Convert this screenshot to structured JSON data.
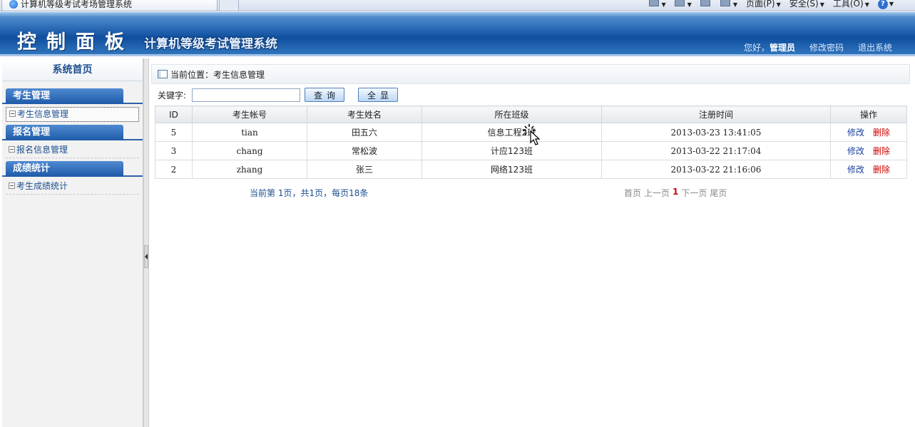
{
  "browser": {
    "tab_title": "计算机等级考试考场管理系统",
    "menus": [
      "页面(P)",
      "安全(S)",
      "工具(O)"
    ],
    "help_glyph": "?"
  },
  "header": {
    "brand": "控制面板",
    "subtitle": "计算机等级考试管理系统",
    "greeting": "您好，",
    "user": "管理员",
    "change_password": "修改密码",
    "logout": "退出系统"
  },
  "sidebar": {
    "home": "系统首页",
    "groups": [
      {
        "title": "考生管理",
        "items": [
          "考生信息管理"
        ]
      },
      {
        "title": "报名管理",
        "items": [
          "报名信息管理"
        ]
      },
      {
        "title": "成绩统计",
        "items": [
          "考生成绩统计"
        ]
      }
    ]
  },
  "breadcrumb": {
    "text": "当前位置：考生信息管理"
  },
  "search": {
    "label": "关键字:",
    "value": "",
    "placeholder": "",
    "query_button": "查询",
    "show_all_button": "全显"
  },
  "table": {
    "headers": [
      "ID",
      "考生帐号",
      "考生姓名",
      "所在班级",
      "注册时间",
      "操作"
    ],
    "rows": [
      {
        "id": "5",
        "account": "tian",
        "name": "田五六",
        "class": "信息工程2班",
        "time": "2013-03-23 13:41:05"
      },
      {
        "id": "3",
        "account": "chang",
        "name": "常松波",
        "class": "计应123班",
        "time": "2013-03-22 21:17:04"
      },
      {
        "id": "2",
        "account": "zhang",
        "name": "张三",
        "class": "网络123班",
        "time": "2013-03-22 21:16:06"
      }
    ],
    "edit_label": "修改",
    "delete_label": "删除"
  },
  "pager": {
    "summary": "当前第 1页，共1页，每页18条",
    "first": "首页",
    "prev": "上一页",
    "current": "1",
    "next": "下一页",
    "last": "尾页"
  },
  "colors": {
    "header_blue": "#0f4f9e",
    "menu_blue": "#1e5aa8",
    "link_blue": "#1b4f8f",
    "delete_red": "#cc0000"
  }
}
